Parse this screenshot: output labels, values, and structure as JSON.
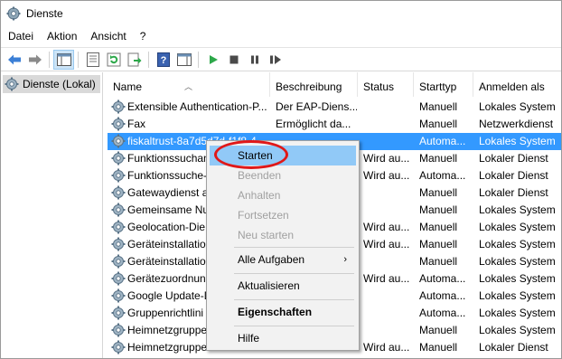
{
  "window": {
    "title": "Dienste"
  },
  "menubar": {
    "items": [
      "Datei",
      "Aktion",
      "Ansicht",
      "?"
    ]
  },
  "tree": {
    "root_label": "Dienste (Lokal)"
  },
  "table": {
    "columns": {
      "name": "Name",
      "beschreibung": "Beschreibung",
      "status": "Status",
      "starttyp": "Starttyp",
      "anmelden": "Anmelden als"
    },
    "rows": [
      {
        "name": "Extensible Authentication-P...",
        "beschreibung": "Der EAP-Diens...",
        "status": "",
        "starttyp": "Manuell",
        "anmelden": "Lokales System"
      },
      {
        "name": "Fax",
        "beschreibung": "Ermöglicht da...",
        "status": "",
        "starttyp": "Manuell",
        "anmelden": "Netzwerkdienst"
      },
      {
        "name": "fiskaltrust-8a7d5d7d-f1f8-4",
        "beschreibung": "",
        "status": "",
        "starttyp": "Automa...",
        "anmelden": "Lokales System",
        "selected": true
      },
      {
        "name": "Funktionssuchan",
        "beschreibung": "",
        "status": "Wird au...",
        "starttyp": "Manuell",
        "anmelden": "Lokaler Dienst"
      },
      {
        "name": "Funktionssuche-",
        "beschreibung": "",
        "status": "Wird au...",
        "starttyp": "Automa...",
        "anmelden": "Lokaler Dienst"
      },
      {
        "name": "Gatewaydienst a",
        "beschreibung": "",
        "status": "",
        "starttyp": "Manuell",
        "anmelden": "Lokaler Dienst"
      },
      {
        "name": "Gemeinsame Nu",
        "beschreibung": "",
        "status": "",
        "starttyp": "Manuell",
        "anmelden": "Lokales System"
      },
      {
        "name": "Geolocation-Die",
        "beschreibung": "",
        "status": "Wird au...",
        "starttyp": "Manuell",
        "anmelden": "Lokales System"
      },
      {
        "name": "Geräteinstallatio",
        "beschreibung": "",
        "status": "Wird au...",
        "starttyp": "Manuell",
        "anmelden": "Lokales System"
      },
      {
        "name": "Geräteinstallatio",
        "beschreibung": "",
        "status": "",
        "starttyp": "Manuell",
        "anmelden": "Lokales System"
      },
      {
        "name": "Gerätezuordnung",
        "beschreibung": "",
        "status": "Wird au...",
        "starttyp": "Automa...",
        "anmelden": "Lokales System"
      },
      {
        "name": "Google Update-D",
        "beschreibung": "",
        "status": "",
        "starttyp": "Automa...",
        "anmelden": "Lokales System"
      },
      {
        "name": "Gruppenrichtlini",
        "beschreibung": "",
        "status": "",
        "starttyp": "Automa...",
        "anmelden": "Lokales System"
      },
      {
        "name": "Heimnetzgruppe",
        "beschreibung": "",
        "status": "",
        "starttyp": "Manuell",
        "anmelden": "Lokales System"
      },
      {
        "name": "Heimnetzgruppe",
        "beschreibung": "",
        "status": "Wird au...",
        "starttyp": "Manuell",
        "anmelden": "Lokaler Dienst"
      }
    ]
  },
  "context_menu": {
    "items": [
      {
        "label": "Starten",
        "state": "highlighted"
      },
      {
        "label": "Beenden",
        "state": "disabled"
      },
      {
        "label": "Anhalten",
        "state": "disabled"
      },
      {
        "label": "Fortsetzen",
        "state": "disabled"
      },
      {
        "label": "Neu starten",
        "state": "disabled"
      },
      {
        "label": "Alle Aufgaben",
        "state": "submenu"
      },
      {
        "label": "Aktualisieren",
        "state": "normal"
      },
      {
        "label": "Eigenschaften",
        "state": "bold"
      },
      {
        "label": "Hilfe",
        "state": "normal"
      }
    ],
    "submenu_arrow": "›"
  },
  "colors": {
    "selection": "#3399ff",
    "menu_highlight": "#91c9f7",
    "annotation_ring": "#e01818",
    "play_green": "#2da84a"
  },
  "toolbar": {
    "icons": [
      "back-arrow-icon",
      "forward-arrow-icon",
      "show-hide-tree-icon",
      "properties-icon",
      "refresh-icon",
      "export-list-icon",
      "help-icon",
      "show-action-pane-icon",
      "play-icon",
      "stop-icon",
      "pause-icon",
      "restart-icon"
    ]
  }
}
